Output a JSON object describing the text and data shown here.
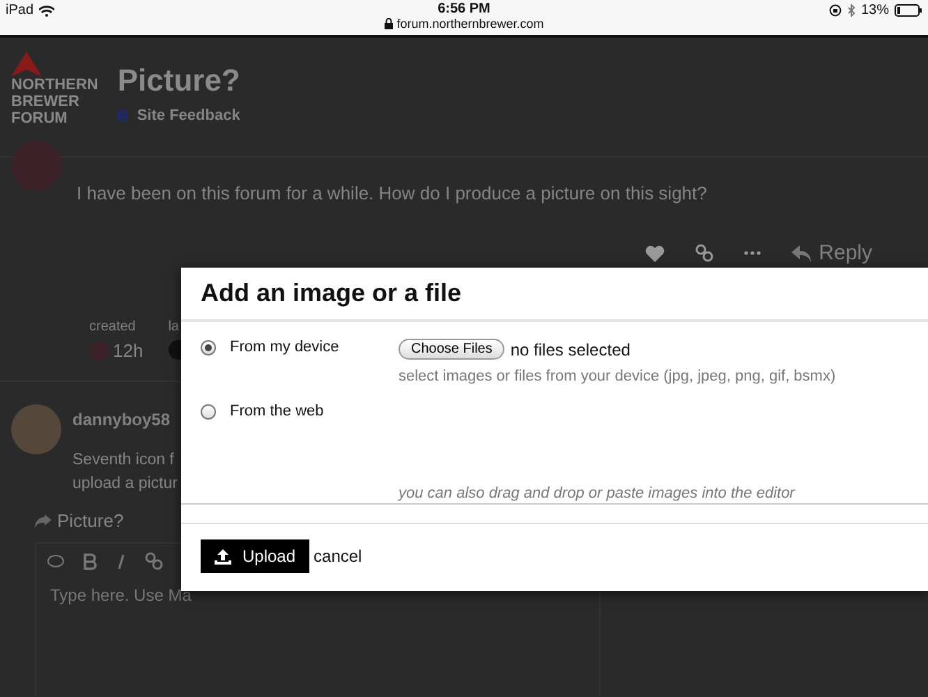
{
  "status_bar": {
    "device": "iPad",
    "time": "6:56 PM",
    "url": "forum.northernbrewer.com",
    "battery": "13%"
  },
  "header": {
    "logo_lines": [
      "NORTHERN",
      "BREWER",
      "FORUM"
    ],
    "title": "Picture?",
    "category": {
      "label": "Site Feedback",
      "color": "#1e2a5a"
    }
  },
  "post": {
    "text": "I have been on this forum for a while. How do I produce a picture on this sight?",
    "reply": "Reply",
    "meta": [
      {
        "label": "created",
        "value": "12h"
      },
      {
        "label": "la"
      }
    ]
  },
  "post2": {
    "author": "dannyboy58",
    "lines": [
      "Seventh icon f",
      "upload a pictur"
    ]
  },
  "composer": {
    "title": "Picture?",
    "placeholder": "Type here. Use Ma"
  },
  "modal": {
    "title": "Add an image or a file",
    "options": [
      {
        "label": "From my device",
        "selected": true
      },
      {
        "label": "From the web",
        "selected": false
      }
    ],
    "choose_button": "Choose Files",
    "file_status": "no files selected",
    "hint": "select images or files from your device (jpg, jpeg, png, gif, bsmx)",
    "drag_hint": "you can also drag and drop or paste images into the editor",
    "upload": "Upload",
    "cancel": "cancel"
  }
}
